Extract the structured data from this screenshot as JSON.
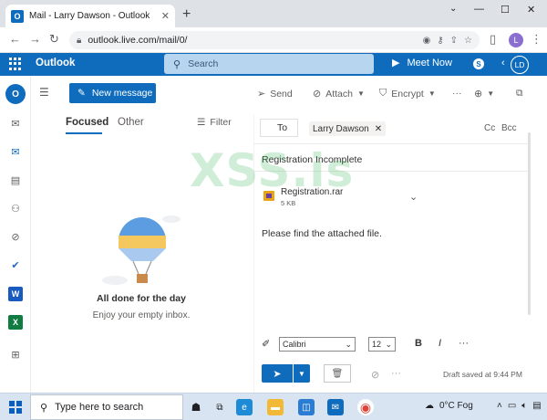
{
  "browser": {
    "tab_title": "Mail - Larry Dawson - Outlook",
    "tab_favicon": "O",
    "url": "outlook.live.com/mail/0/",
    "profile_initial": "L"
  },
  "header": {
    "app_name": "Outlook",
    "search_placeholder": "Search",
    "meet_now": "Meet Now",
    "avatar_initials": "LD",
    "brand_color": "#0f6cbd"
  },
  "rail": {
    "logo_letter": "O",
    "word_letter": "W",
    "excel_letter": "X"
  },
  "command_bar": {
    "new_message": "New message",
    "send": "Send",
    "attach": "Attach",
    "encrypt": "Encrypt"
  },
  "message_list": {
    "tab_focused": "Focused",
    "tab_other": "Other",
    "filter": "Filter",
    "empty_title": "All done for the day",
    "empty_subtitle": "Enjoy your empty inbox."
  },
  "compose": {
    "to_label": "To",
    "recipient": "Larry Dawson",
    "cc": "Cc",
    "bcc": "Bcc",
    "subject": "Registration Incomplete",
    "attachment_name": "Registration.rar",
    "attachment_size": "5 KB",
    "body": "Please find the attached file.",
    "font": "Calibri",
    "font_size": "12",
    "draft_status": "Draft saved at 9:44 PM"
  },
  "watermark": "XSS.is",
  "taskbar": {
    "search_placeholder": "Type here to search",
    "weather": "0°C  Fog"
  }
}
